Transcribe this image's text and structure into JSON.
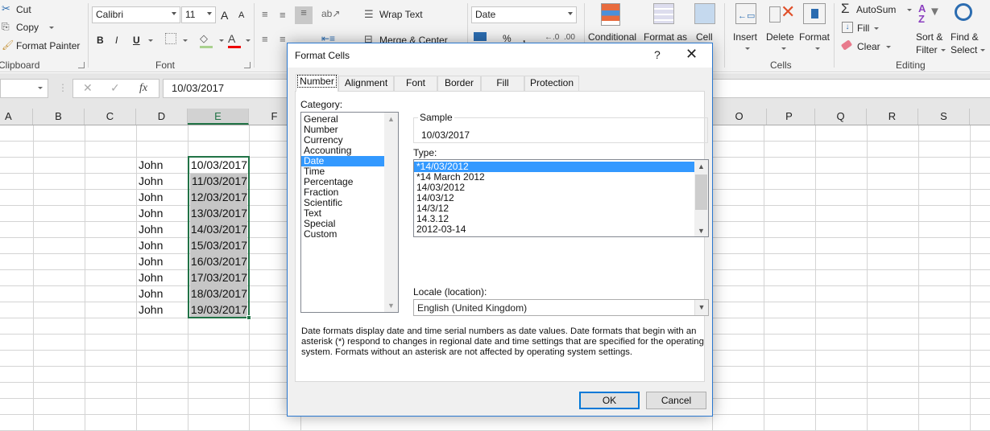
{
  "ribbon": {
    "clipboard": {
      "cut": "Cut",
      "copy": "Copy",
      "format_painter": "Format Painter",
      "group_label": "Clipboard"
    },
    "font": {
      "font_name": "Calibri",
      "font_size": "11",
      "bold": "B",
      "italic": "I",
      "underline": "U",
      "grow": "A",
      "shrink": "A",
      "font_color": "A",
      "group_label": "Font"
    },
    "alignment": {
      "wrap_text": "Wrap Text",
      "merge_center": "Merge & Center"
    },
    "number": {
      "format": "Date",
      "percent": "%",
      "comma": ","
    },
    "styles": {
      "conditional": "Conditional",
      "format_as": "Format as",
      "cell": "Cell"
    },
    "cells": {
      "insert": "Insert",
      "delete": "Delete",
      "format": "Format",
      "group_label": "Cells"
    },
    "editing": {
      "autosum": "AutoSum",
      "fill": "Fill",
      "clear": "Clear",
      "sort": "Sort &",
      "filter": "Filter",
      "find": "Find &",
      "select": "Select",
      "group_label": "Editing"
    }
  },
  "formula_bar": {
    "name_box": "",
    "cancel": "✕",
    "enter": "✓",
    "fx": "fx",
    "value": "10/03/2017"
  },
  "sheet": {
    "columns": [
      "A",
      "B",
      "C",
      "D",
      "E",
      "F",
      "O",
      "P",
      "Q",
      "R",
      "S"
    ],
    "selected_column": "E",
    "rows": [
      {
        "name": "John",
        "date": "10/03/2017"
      },
      {
        "name": "John",
        "date": "11/03/2017"
      },
      {
        "name": "John",
        "date": "12/03/2017"
      },
      {
        "name": "John",
        "date": "13/03/2017"
      },
      {
        "name": "John",
        "date": "14/03/2017"
      },
      {
        "name": "John",
        "date": "15/03/2017"
      },
      {
        "name": "John",
        "date": "16/03/2017"
      },
      {
        "name": "John",
        "date": "17/03/2017"
      },
      {
        "name": "John",
        "date": "18/03/2017"
      },
      {
        "name": "John",
        "date": "19/03/2017"
      }
    ]
  },
  "dialog": {
    "title": "Format Cells",
    "help": "?",
    "close": "✕",
    "tabs": [
      "Number",
      "Alignment",
      "Font",
      "Border",
      "Fill",
      "Protection"
    ],
    "active_tab": "Number",
    "category_label": "Category:",
    "categories": [
      "General",
      "Number",
      "Currency",
      "Accounting",
      "Date",
      "Time",
      "Percentage",
      "Fraction",
      "Scientific",
      "Text",
      "Special",
      "Custom"
    ],
    "selected_category": "Date",
    "sample_label": "Sample",
    "sample_value": "10/03/2017",
    "type_label": "Type:",
    "types": [
      "*14/03/2012",
      "*14 March 2012",
      "14/03/2012",
      "14/03/12",
      "14/3/12",
      "14.3.12",
      "2012-03-14"
    ],
    "selected_type": "*14/03/2012",
    "locale_label": "Locale (location):",
    "locale_value": "English (United Kingdom)",
    "description": "Date formats display date and time serial numbers as date values.  Date formats that begin with an asterisk (*) respond to changes in regional date and time settings that are specified for the operating system. Formats without an asterisk are not affected by operating system settings.",
    "ok": "OK",
    "cancel": "Cancel"
  }
}
